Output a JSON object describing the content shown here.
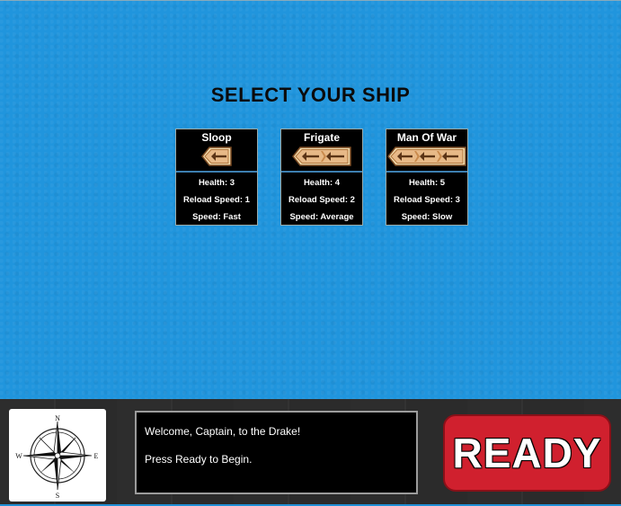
{
  "screen": {
    "title": "SELECT YOUR SHIP"
  },
  "ships": [
    {
      "name": "Sloop",
      "health": "Health: 3",
      "reload": "Reload Speed:  1",
      "speed": "Speed: Fast",
      "icon": "sloop-ship-icon",
      "segments": 1
    },
    {
      "name": "Frigate",
      "health": "Health: 4",
      "reload": "Reload Speed:  2",
      "speed": "Speed: Average",
      "icon": "frigate-ship-icon",
      "segments": 2
    },
    {
      "name": "Man Of War",
      "health": "Health: 5",
      "reload": "Reload Speed:  3",
      "speed": "Speed: Slow",
      "icon": "man-of-war-ship-icon",
      "segments": 3
    }
  ],
  "compass": {
    "n": "N",
    "s": "S",
    "e": "E",
    "w": "W"
  },
  "message": {
    "line1": "Welcome, Captain, to the Drake!",
    "line2": "Press Ready to Begin."
  },
  "ready_button": {
    "label": "READY"
  },
  "colors": {
    "sea": "#2095dd",
    "ready": "#d0202e",
    "card": "#000000"
  }
}
